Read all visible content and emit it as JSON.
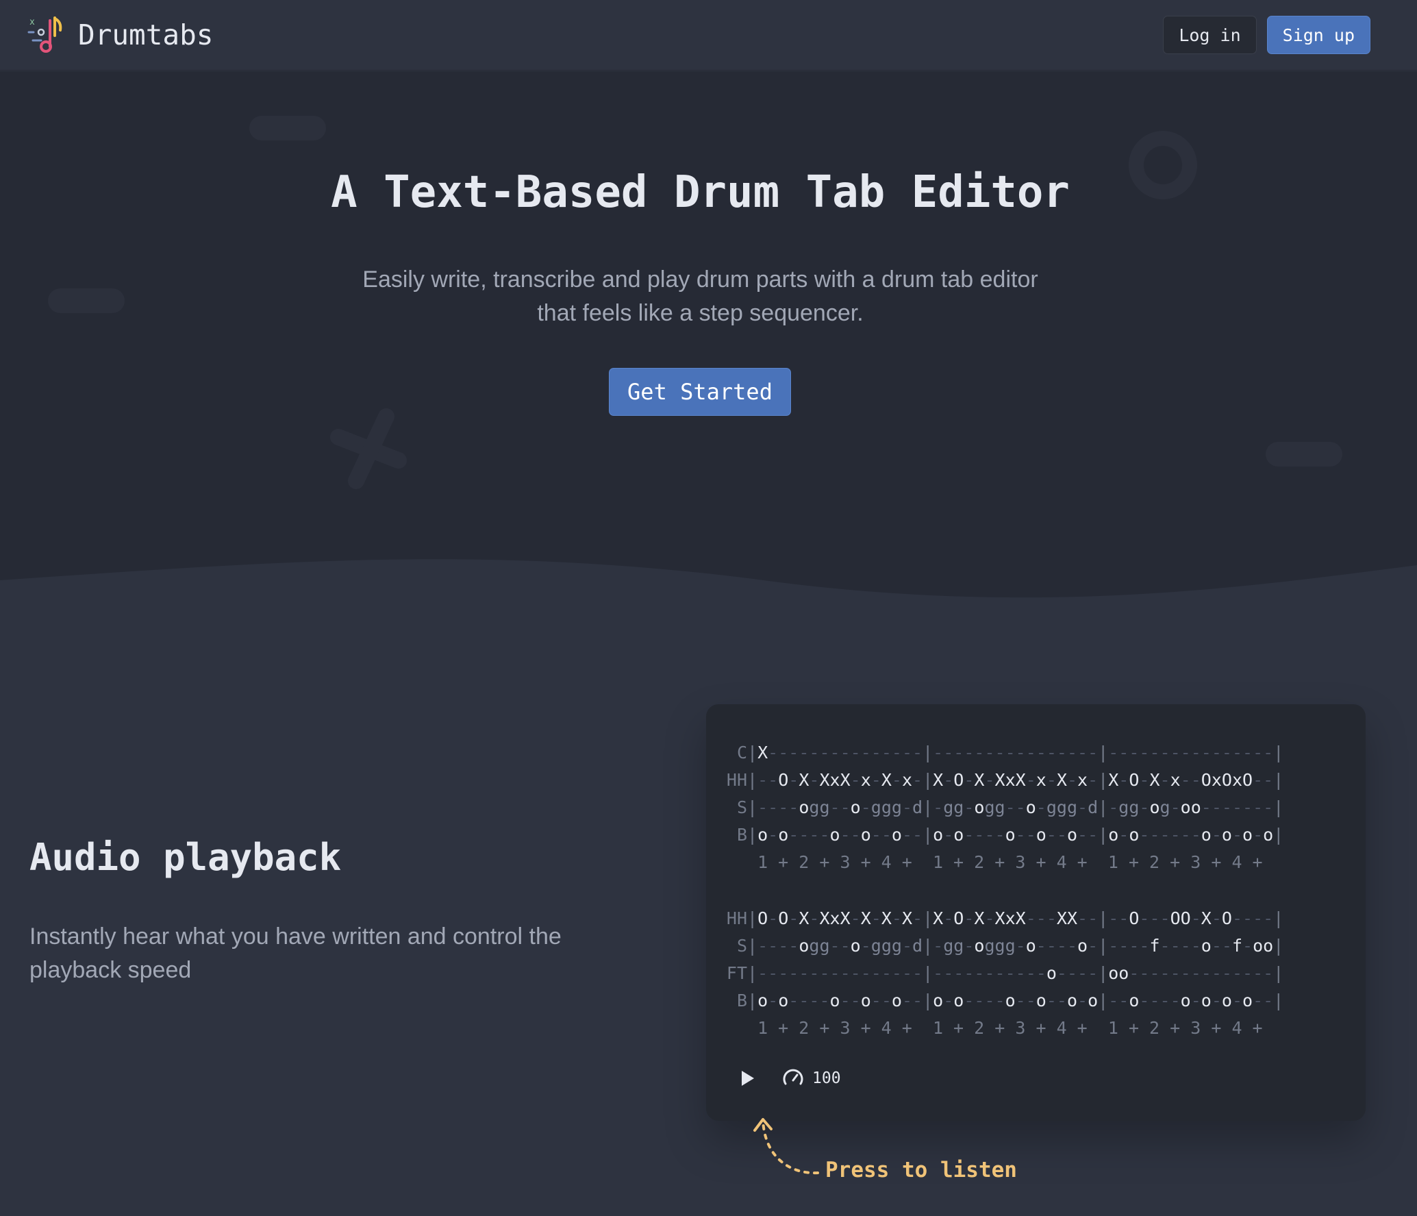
{
  "header": {
    "brand": "Drumtabs",
    "login_label": "Log in",
    "signup_label": "Sign up"
  },
  "hero": {
    "title": "A Text-Based Drum Tab Editor",
    "subtitle_line1": "Easily write, transcribe and play drum parts with a drum tab editor",
    "subtitle_line2": "that feels like a step sequencer.",
    "cta_label": "Get Started"
  },
  "feature": {
    "title": "Audio playback",
    "description_line1": "Instantly hear what you have written and control the",
    "description_line2": "playback speed"
  },
  "tab": {
    "blocks": [
      {
        "lines": [
          {
            "label": "C",
            "measures": [
              "X---------------",
              "----------------",
              "----------------"
            ]
          },
          {
            "label": "HH",
            "measures": [
              "--O-X-XxX-x-X-x-",
              "X-O-X-XxX-x-X-x-",
              "X-O-X-x--OxOxO--"
            ]
          },
          {
            "label": "S",
            "measures": [
              "----ogg--o-ggg-d",
              "-gg-ogg--o-ggg-d",
              "-gg-og-oo-------"
            ]
          },
          {
            "label": "B",
            "measures": [
              "o-o----o--o--o--",
              "o-o----o--o--o--",
              "o-o------o-o-o-o"
            ]
          }
        ],
        "count": "1 + 2 + 3 + 4 +"
      },
      {
        "lines": [
          {
            "label": "HH",
            "measures": [
              "O-O-X-XxX-X-X-X-",
              "X-O-X-XxX---XX--",
              "--O---OO-X-O----"
            ]
          },
          {
            "label": "S",
            "measures": [
              "----ogg--o-ggg-d",
              "-gg-oggg-o----o-",
              "----f----o--f-oo"
            ]
          },
          {
            "label": "FT",
            "measures": [
              "----------------",
              "-----------o----",
              "oo--------------"
            ]
          },
          {
            "label": "B",
            "measures": [
              "o-o----o--o--o--",
              "o-o----o--o--o-o",
              "--o----o-o-o-o--"
            ]
          }
        ],
        "count": "1 + 2 + 3 + 4 +"
      }
    ]
  },
  "player": {
    "play_icon": "play-icon",
    "tempo_icon": "speedometer-icon",
    "tempo": "100"
  },
  "hint": {
    "text": "Press to listen"
  },
  "colors": {
    "background": "#2e3340",
    "hero_background": "#262a35",
    "accent": "#4a73ba",
    "hint": "#f0c378",
    "logo_pink": "#e2547a",
    "logo_yellow": "#f0c04a"
  }
}
